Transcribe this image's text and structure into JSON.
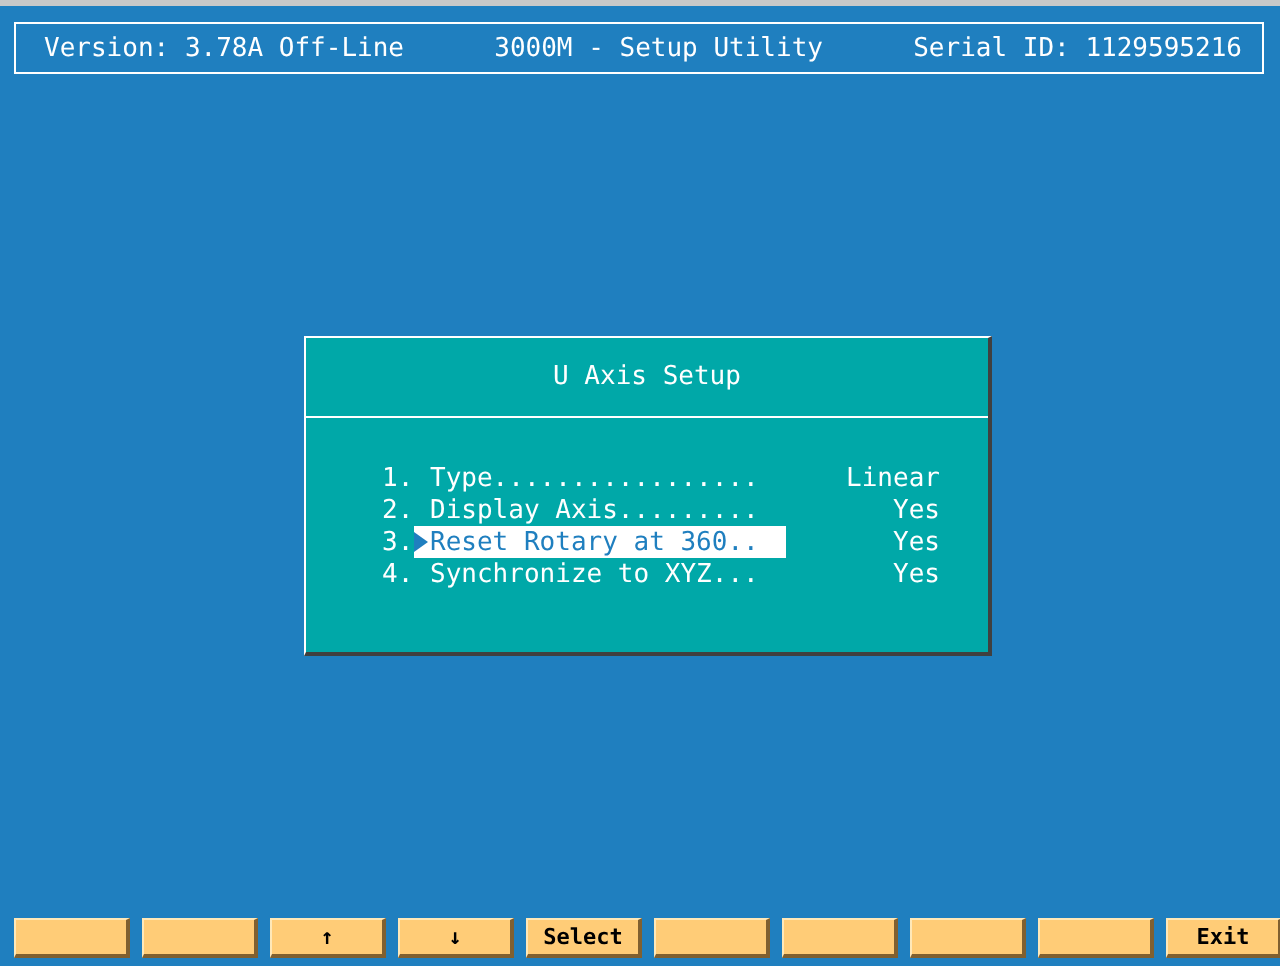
{
  "header": {
    "version": "Version: 3.78A Off-Line",
    "title": "3000M - Setup Utility",
    "serial": "Serial ID: 1129595216"
  },
  "dialog": {
    "title": "U Axis Setup",
    "items": [
      {
        "number": "1.",
        "label": "Type.................",
        "value": "Linear",
        "selected": false
      },
      {
        "number": "2.",
        "label": "Display Axis.........",
        "value": "Yes",
        "selected": false
      },
      {
        "number": "3.",
        "label": "Reset Rotary at 360..",
        "value": "Yes",
        "selected": true
      },
      {
        "number": "4.",
        "label": "Synchronize to XYZ...",
        "value": "Yes",
        "selected": false
      }
    ]
  },
  "function_keys": [
    {
      "kind": "blank"
    },
    {
      "kind": "blank"
    },
    {
      "kind": "labeled",
      "label": "↑"
    },
    {
      "kind": "labeled",
      "label": "↓"
    },
    {
      "kind": "labeled",
      "label": "Select"
    },
    {
      "kind": "blank"
    },
    {
      "kind": "blank"
    },
    {
      "kind": "blank"
    },
    {
      "kind": "blank"
    },
    {
      "kind": "labeled",
      "label": "Exit"
    }
  ]
}
